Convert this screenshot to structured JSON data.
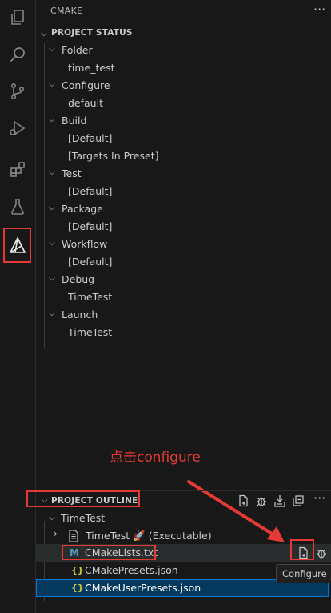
{
  "activity_bar": {
    "items": [
      {
        "name": "explorer-icon"
      },
      {
        "name": "search-icon"
      },
      {
        "name": "source-control-icon"
      },
      {
        "name": "run-debug-icon"
      },
      {
        "name": "extensions-icon"
      },
      {
        "name": "testing-icon"
      },
      {
        "name": "cmake-icon",
        "active": true
      }
    ]
  },
  "sidebar": {
    "title": "CMAKE",
    "more_label": "···"
  },
  "project_status": {
    "title": "PROJECT STATUS",
    "folder": {
      "label": "Folder",
      "value": "time_test"
    },
    "configure": {
      "label": "Configure",
      "value": "default"
    },
    "build": {
      "label": "Build",
      "value1": "[Default]",
      "value2": "[Targets In Preset]"
    },
    "test": {
      "label": "Test",
      "value": "[Default]"
    },
    "package": {
      "label": "Package",
      "value": "[Default]"
    },
    "workflow": {
      "label": "Workflow",
      "value": "[Default]"
    },
    "debug": {
      "label": "Debug",
      "value": "TimeTest"
    },
    "launch": {
      "label": "Launch",
      "value": "TimeTest"
    }
  },
  "annotation": {
    "text": "点击configure"
  },
  "project_outline": {
    "title": "PROJECT OUTLINE",
    "project": "TimeTest",
    "target": {
      "label": "TimeTest",
      "emoji": "🚀",
      "kind": "(Executable)"
    },
    "files": [
      {
        "label": "CMakeLists.txt",
        "icon": "M"
      },
      {
        "label": "CMakePresets.json",
        "icon": "{}"
      },
      {
        "label": "CMakeUserPresets.json",
        "icon": "{}"
      }
    ]
  },
  "tooltip": {
    "text": "Configure"
  },
  "colors": {
    "accent": "#0078d4",
    "highlight_red": "#e53935",
    "background": "#181818"
  }
}
